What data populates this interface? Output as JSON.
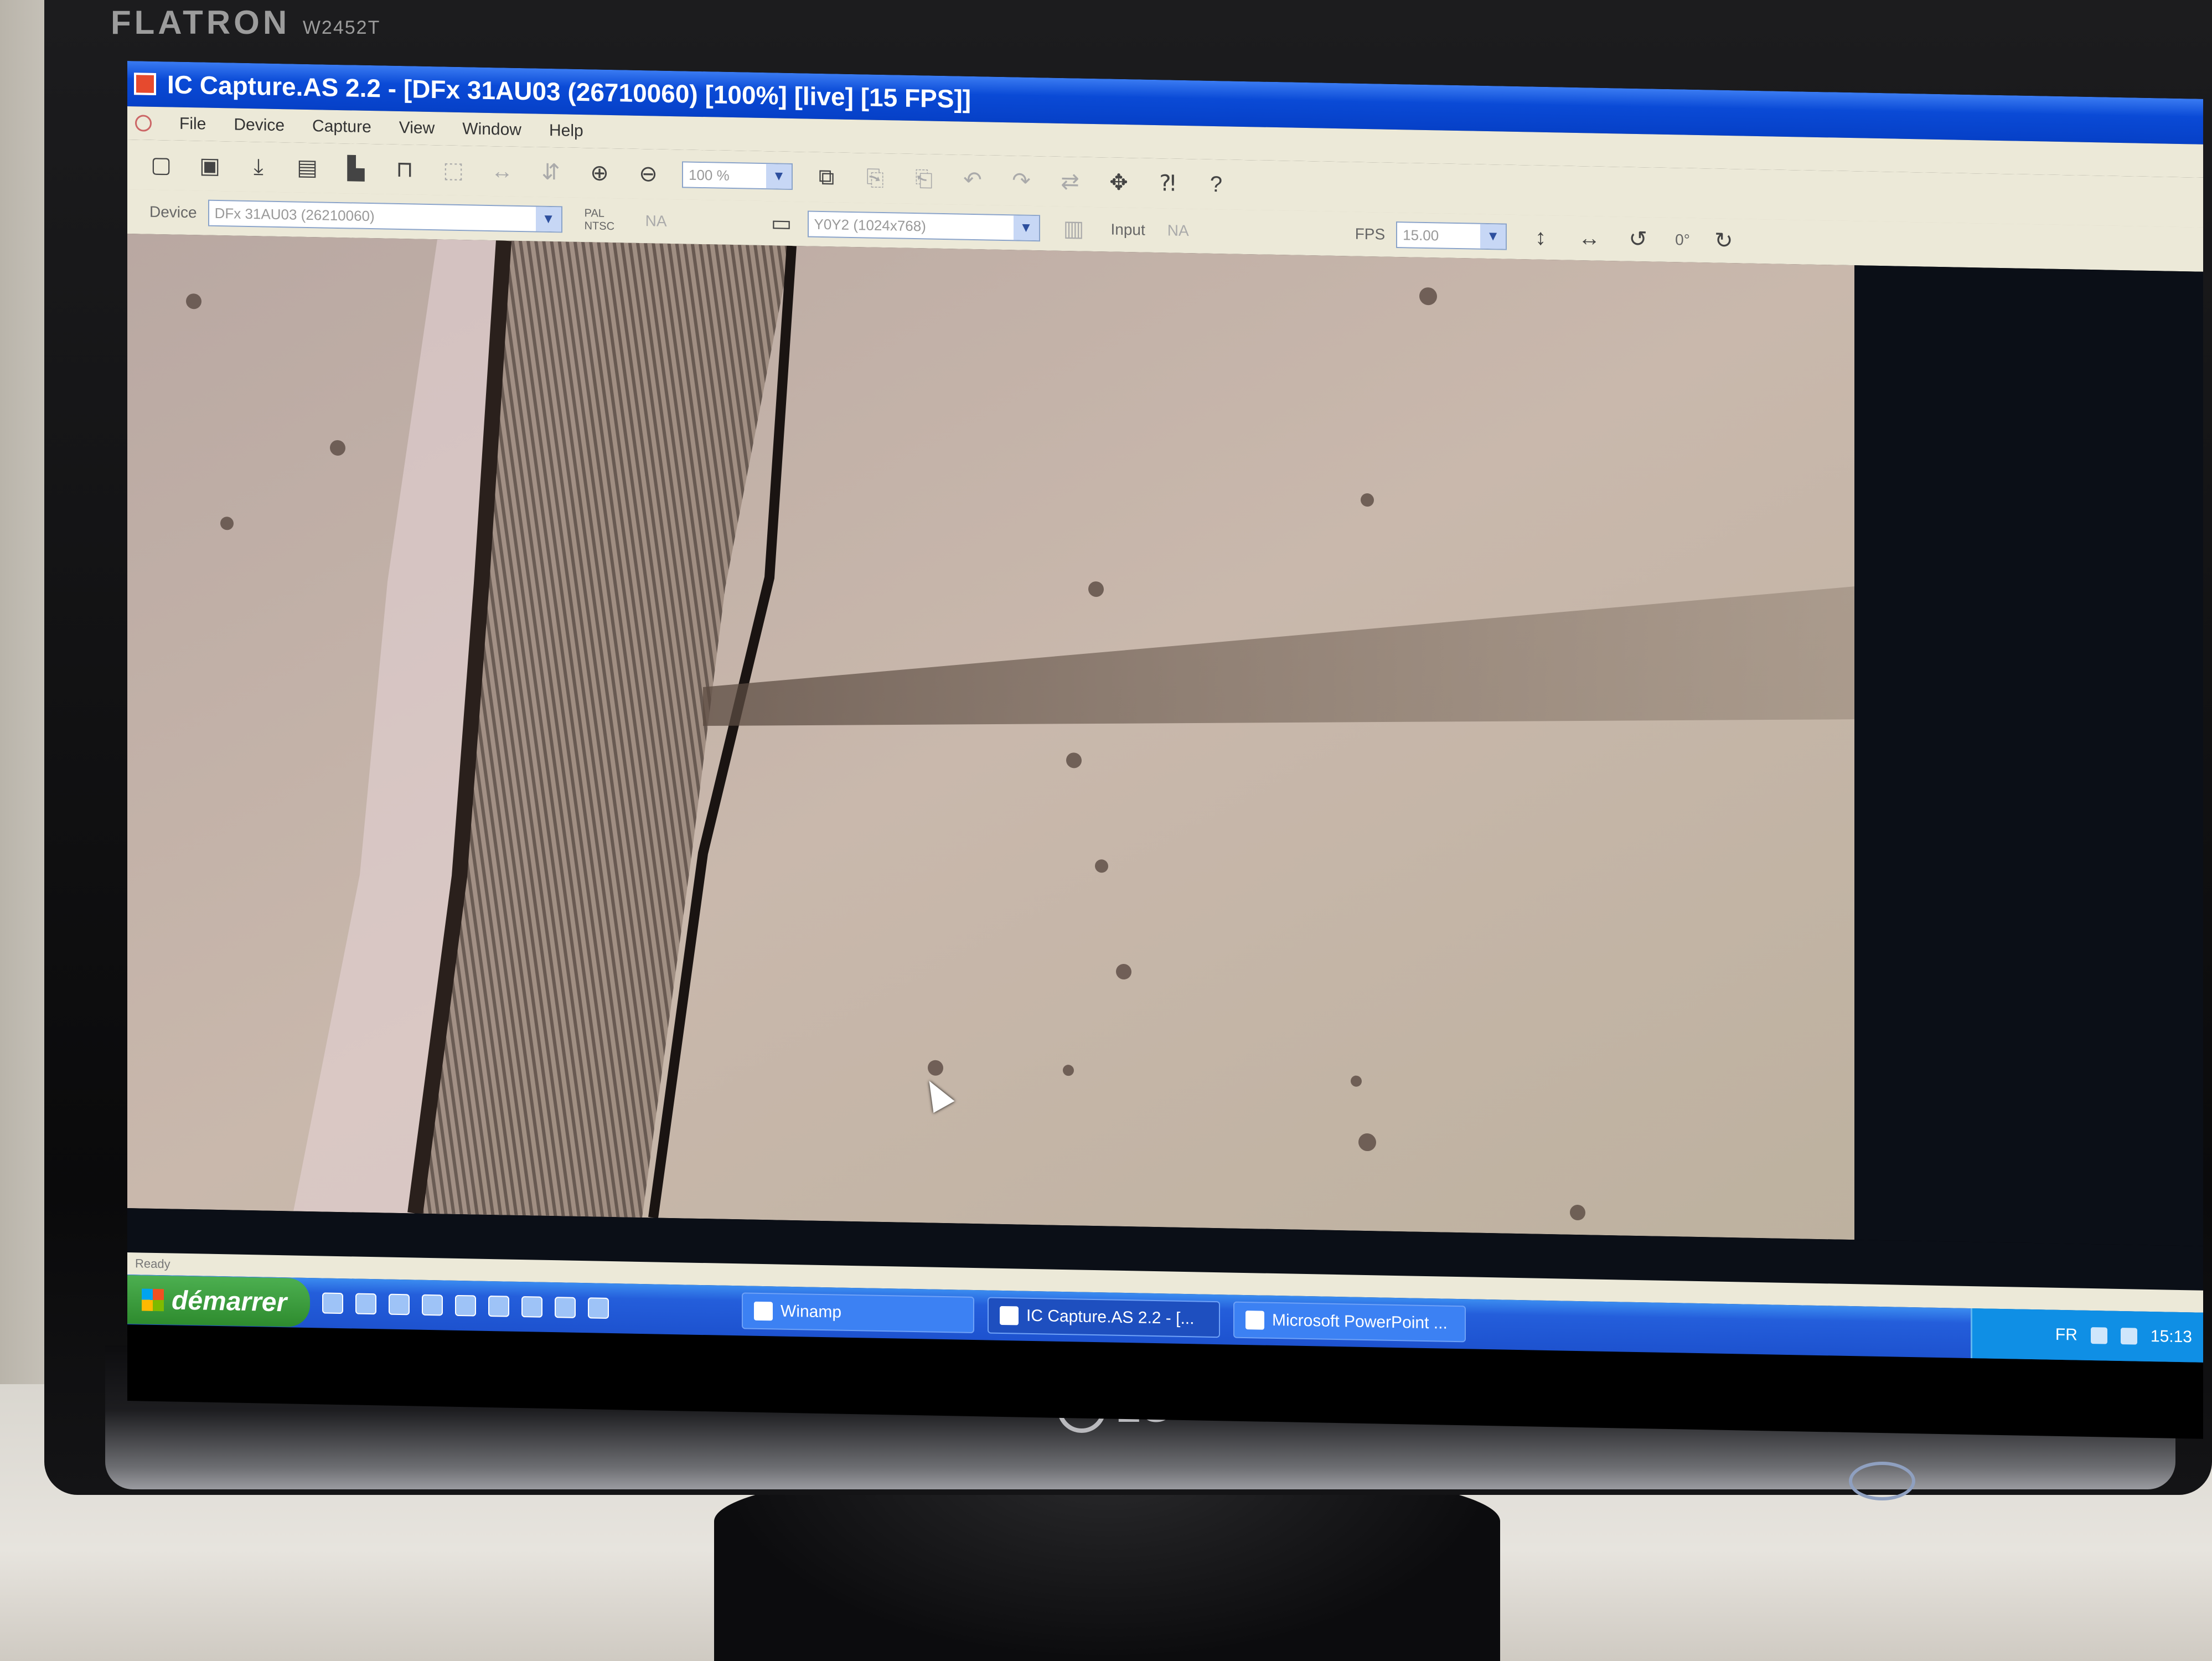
{
  "monitor": {
    "brand_top": "FLATRON",
    "model": "W2452T",
    "brand_bottom": "LG"
  },
  "window": {
    "title": "IC Capture.AS 2.2 - [DFx 31AU03 (26710060) [100%] [live] [15 FPS]]"
  },
  "menu": {
    "items": [
      "File",
      "Device",
      "Capture",
      "View",
      "Window",
      "Help"
    ]
  },
  "toolbar": {
    "zoom_value": "100 %"
  },
  "device_bar": {
    "device_label": "Device",
    "device_value": "DFx 31AU03 (26210060)",
    "ntsc_label": "PAL NTSC",
    "na_1": "NA",
    "format_value": "Y0Y2 (1024x768)",
    "input_label": "Input",
    "na_2": "NA",
    "fps_label": "FPS",
    "fps_value": "15.00",
    "rotation_value": "0°"
  },
  "statusbar": {
    "text": "Ready"
  },
  "taskbar": {
    "start_label": "démarrer",
    "tasks": [
      "Winamp",
      "IC Capture.AS 2.2 - [...",
      "Microsoft PowerPoint ..."
    ],
    "tray_lang": "FR",
    "clock": "15:13"
  },
  "colors": {
    "xp_title_blue": "#0a4ad6",
    "xp_taskbar_blue": "#245edb",
    "start_green": "#3a9d3a",
    "video_tint": "#c7b7ab"
  }
}
